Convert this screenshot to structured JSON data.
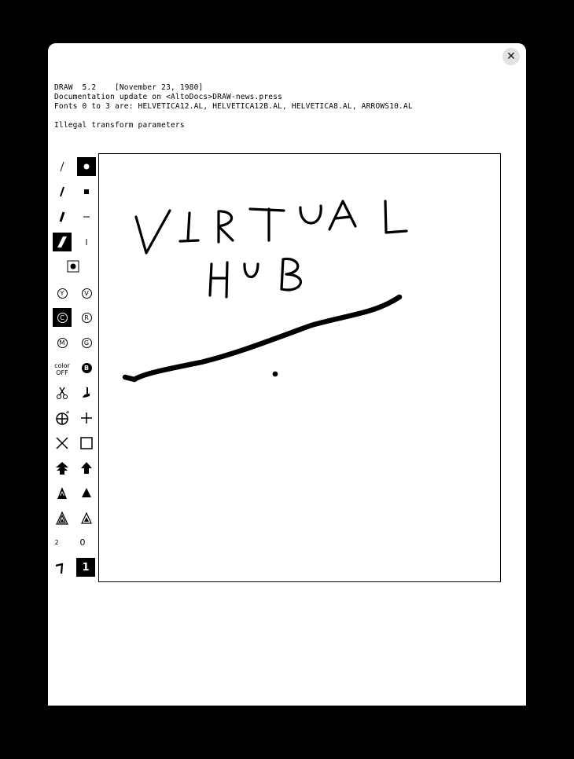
{
  "header": {
    "line1": "DRAW  5.2    [November 23, 1980]",
    "line2": "Documentation update on <AltoDocs>DRAW-news.press",
    "line3": "Fonts 0 to 3 are: HELVETICA12.AL, HELVETICA12B.AL, HELVETICA8.AL, ARROWS10.AL",
    "message": "Illegal transform parameters"
  },
  "window": {
    "close_glyph": "✕"
  },
  "palette": {
    "brush_m": "M",
    "brush_g": "G",
    "brush_y": "Y",
    "brush_v": "V",
    "brush_c": "C",
    "brush_r": "R",
    "brush_b": "B",
    "color_label": "color",
    "color_state": "OFF",
    "font_small": "2",
    "font_zero": "0",
    "font_one": "1"
  }
}
